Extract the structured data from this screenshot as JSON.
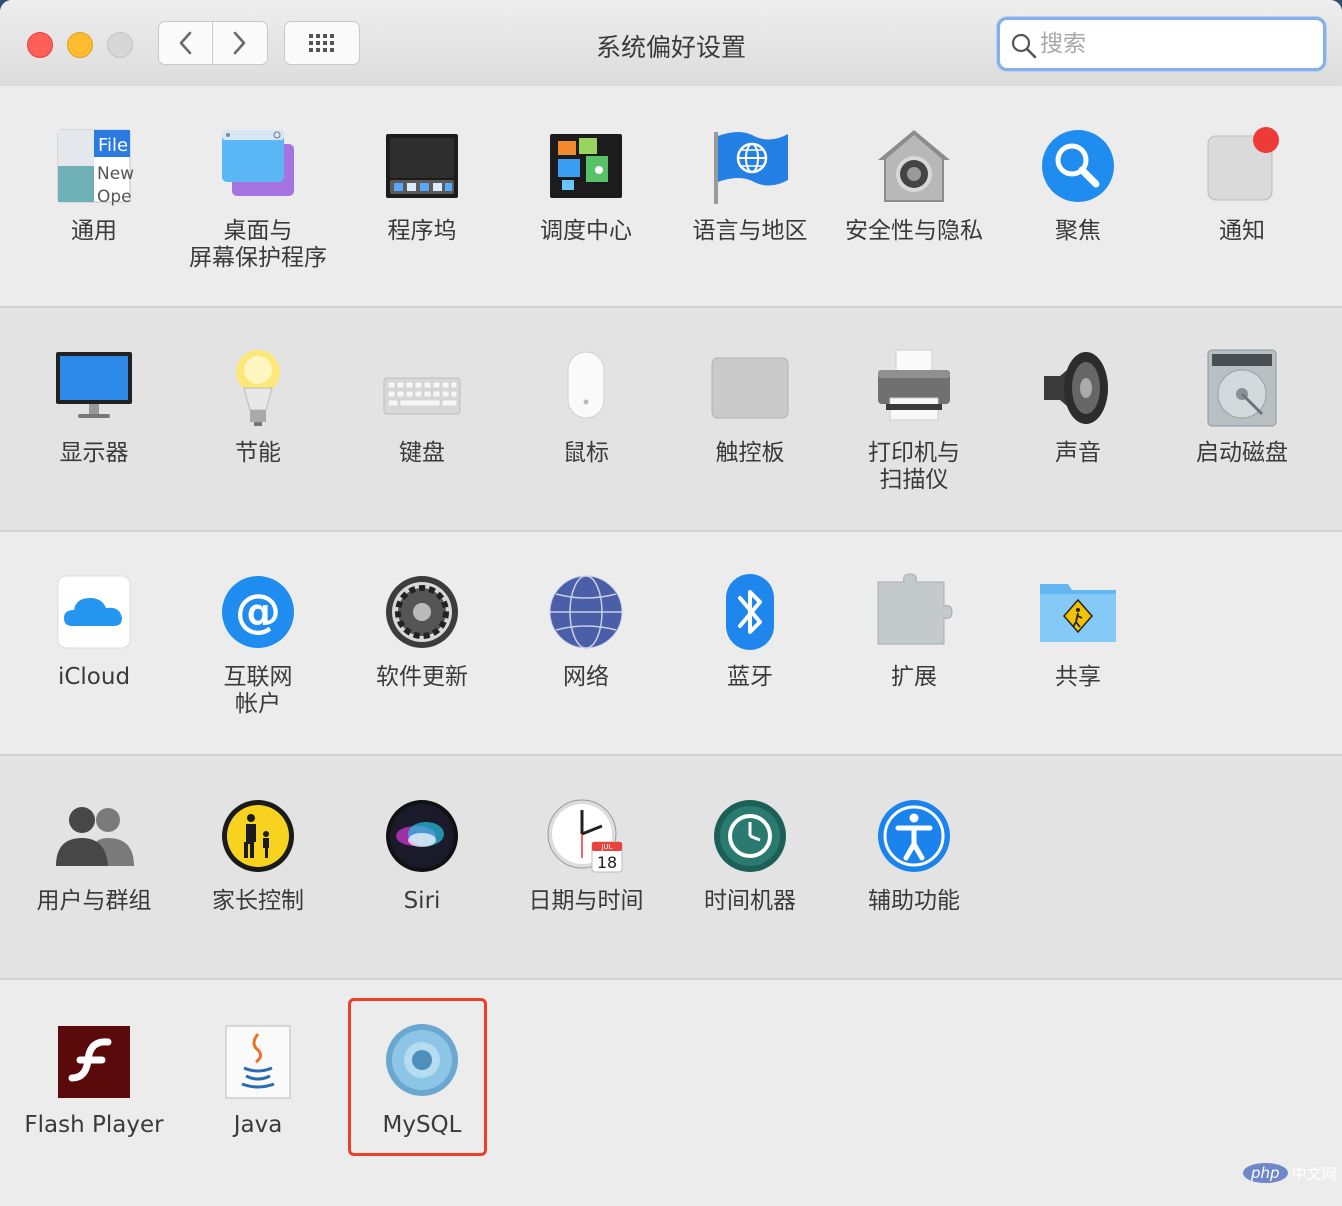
{
  "window": {
    "title": "系统偏好设置"
  },
  "search": {
    "placeholder": "搜索"
  },
  "sections": [
    {
      "items": [
        "通用",
        "桌面与\n屏幕保护程序",
        "程序坞",
        "调度中心",
        "语言与地区",
        "安全性与隐私",
        "聚焦",
        "通知"
      ]
    },
    {
      "items": [
        "显示器",
        "节能",
        "键盘",
        "鼠标",
        "触控板",
        "打印机与\n扫描仪",
        "声音",
        "启动磁盘"
      ]
    },
    {
      "items": [
        "iCloud",
        "互联网\n帐户",
        "软件更新",
        "网络",
        "蓝牙",
        "扩展",
        "共享"
      ]
    },
    {
      "items": [
        "用户与群组",
        "家长控制",
        "Siri",
        "日期与时间",
        "时间机器",
        "辅助功能"
      ]
    },
    {
      "items": [
        "Flash Player",
        "Java",
        "MySQL"
      ]
    }
  ],
  "icons": {
    "general": {
      "file": "File",
      "new": "New",
      "open": "Ope"
    },
    "datetime": {
      "month": "JUL",
      "day": "18"
    }
  },
  "watermark": {
    "badge": "php",
    "text": "中文网"
  },
  "colors": {
    "highlight": "#ee3e2a",
    "search_focus": "#86aeea",
    "close": "#fe5f57",
    "minimize": "#febc2e"
  }
}
